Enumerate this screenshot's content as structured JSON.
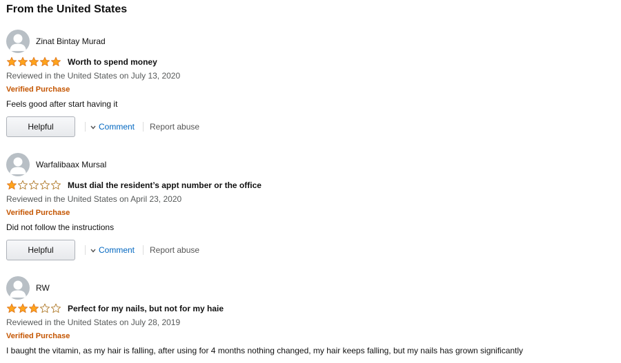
{
  "section": {
    "title": "From the United States"
  },
  "reviews": [
    {
      "author": "Zinat Bintay Murad",
      "rating": 5,
      "rating_max": 5,
      "title": "Worth to spend money",
      "date": "Reviewed in the United States on July 13, 2020",
      "verified": "Verified Purchase",
      "body": "Feels good after start having it",
      "helpful_label": "Helpful",
      "comment_label": "Comment",
      "report_label": "Report abuse"
    },
    {
      "author": "Warfalibaax Mursal",
      "rating": 1,
      "rating_max": 5,
      "title": "Must dial the resident’s appt number or the office",
      "date": "Reviewed in the United States on April 23, 2020",
      "verified": "Verified Purchase",
      "body": "Did not follow the instructions",
      "helpful_label": "Helpful",
      "comment_label": "Comment",
      "report_label": "Report abuse"
    },
    {
      "author": "RW",
      "rating": 3,
      "rating_max": 5,
      "title": "Perfect for my nails, but not for my haie",
      "date": "Reviewed in the United States on July 28, 2019",
      "verified": "Verified Purchase",
      "body": "I baught the vitamin, as my hair is falling, after using for 4 months nothing changed, my hair keeps falling, but my nails has grown significantly"
    }
  ],
  "colors": {
    "star_fill": "#ffa41c",
    "star_stroke": "#de7921",
    "verified": "#c45500",
    "link": "#0066c0",
    "muted": "#565959"
  },
  "icons": {
    "avatar": "default-profile-icon",
    "star": "star-icon",
    "chevron": "chevron-down-icon"
  }
}
